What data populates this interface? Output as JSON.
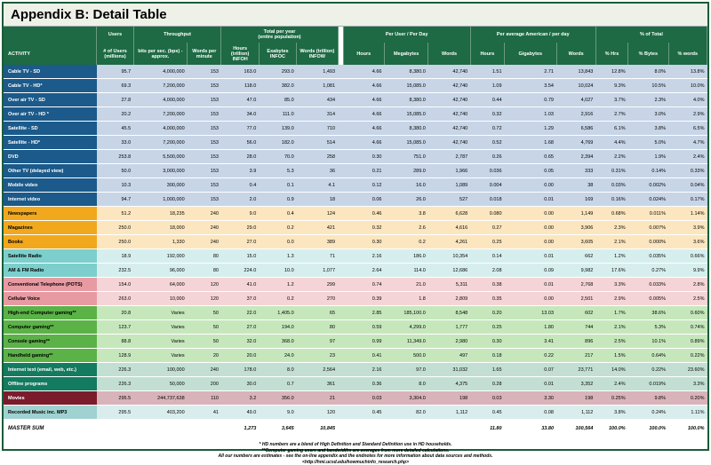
{
  "title": "Appendix B: Detail Table",
  "header_groups": {
    "users": "Users",
    "throughput": "Throughput",
    "total_per_year": "Total per year",
    "total_per_year_sub": "(entire population)",
    "per_user_day": "Per User / Per Day",
    "per_american_day": "Per average American / per day",
    "pct_total": "% of Total"
  },
  "columns": [
    "ACTIVITY",
    "# of Users (millions)",
    "bits per sec. (bps) - approx.",
    "Words per minute",
    "Hours (trillion) INFOH",
    "Exabytes INFOC",
    "Words (trillion) INFOW",
    "Hours",
    "Megabytes",
    "Words",
    "Hours",
    "Gigabytes",
    "Words",
    "% Hrs",
    "% Bytes",
    "% words"
  ],
  "colors": {
    "header_bg": "#1d6a44",
    "tv_label": "#1b5a8a",
    "tv_row": "#c7d5e7",
    "print_label": "#f2a81c",
    "print_row": "#fce6bf",
    "radio_label": "#7ccfcc",
    "radio_row": "#d6efee",
    "phone_label": "#e89aa2",
    "phone_row": "#f5d4d7",
    "game_label": "#5bb247",
    "game_row": "#c6e7bc",
    "net_label": "#137b5f",
    "net_row": "#c3dfd4",
    "movie_label": "#7b1c2c",
    "movie_row": "#d9b3ba",
    "mp3_label": "#9fd2d0",
    "mp3_row": "#d9eded"
  },
  "rows": [
    {
      "group": "tv",
      "cells": [
        "Cable TV - SD",
        "95.7",
        "4,000,000",
        "153",
        "163.0",
        "293.0",
        "1,493",
        "4.66",
        "8,380.0",
        "42,740",
        "1.51",
        "2.71",
        "13,843",
        "12.8%",
        "8.0%",
        "13.8%"
      ]
    },
    {
      "group": "tv",
      "cells": [
        "Cable TV - HD*",
        "69.3",
        "7,200,000",
        "153",
        "118.0",
        "382.0",
        "1,081",
        "4.66",
        "15,085.0",
        "42,740",
        "1.09",
        "3.54",
        "10,024",
        "9.3%",
        "10.5%",
        "10.0%"
      ]
    },
    {
      "group": "tv",
      "cells": [
        "Over air TV - SD",
        "27.8",
        "4,000,000",
        "153",
        "47.0",
        "85.0",
        "434",
        "4.66",
        "8,380.0",
        "42,740",
        "0.44",
        "0.79",
        "4,027",
        "3.7%",
        "2.3%",
        "4.0%"
      ]
    },
    {
      "group": "tv",
      "cells": [
        "Over air TV - HD *",
        "20.2",
        "7,200,000",
        "153",
        "34.0",
        "111.0",
        "314",
        "4.66",
        "15,085.0",
        "42,740",
        "0.32",
        "1.03",
        "2,916",
        "2.7%",
        "3.0%",
        "2.9%"
      ]
    },
    {
      "group": "tv",
      "cells": [
        "Satellite - SD",
        "45.5",
        "4,000,000",
        "153",
        "77.0",
        "139.0",
        "710",
        "4.66",
        "8,380.0",
        "42,740",
        "0.72",
        "1.29",
        "6,586",
        "6.1%",
        "3.8%",
        "6.5%"
      ]
    },
    {
      "group": "tv",
      "cells": [
        "Satellite - HD*",
        "33.0",
        "7,200,000",
        "153",
        "56.0",
        "182.0",
        "514",
        "4.66",
        "15,085.0",
        "42,740",
        "0.52",
        "1.68",
        "4,769",
        "4.4%",
        "5.0%",
        "4.7%"
      ]
    },
    {
      "group": "tv",
      "cells": [
        "DVD",
        "253.8",
        "5,500,000",
        "153",
        "28.0",
        "70.0",
        "258",
        "0.30",
        "751.0",
        "2,787",
        "0.26",
        "0.65",
        "2,394",
        "2.2%",
        "1.9%",
        "2.4%"
      ]
    },
    {
      "group": "tv",
      "cells": [
        "Other TV (delayed view)",
        "50.0",
        "3,000,000",
        "153",
        "3.9",
        "5.3",
        "36",
        "0.21",
        "289.0",
        "1,966",
        "0.036",
        "0.05",
        "333",
        "0.31%",
        "0.14%",
        "0.33%"
      ]
    },
    {
      "group": "tv",
      "cells": [
        "Mobile video",
        "10.3",
        "300,000",
        "153",
        "0.4",
        "0.1",
        "4.1",
        "0.12",
        "16.0",
        "1,089",
        "0.004",
        "0.00",
        "38",
        "0.03%",
        "0.002%",
        "0.04%"
      ]
    },
    {
      "group": "tv",
      "cells": [
        "Internet video",
        "94.7",
        "1,000,000",
        "153",
        "2.0",
        "0.9",
        "18",
        "0.06",
        "26.0",
        "527",
        "0.018",
        "0.01",
        "169",
        "0.16%",
        "0.024%",
        "0.17%"
      ]
    },
    {
      "group": "print",
      "cells": [
        "Newspapers",
        "51.2",
        "18,235",
        "240",
        "9.0",
        "0.4",
        "124",
        "0.46",
        "3.8",
        "6,628",
        "0.080",
        "0.00",
        "1,149",
        "0.68%",
        "0.011%",
        "1.14%"
      ]
    },
    {
      "group": "print",
      "cells": [
        "Magazines",
        "250.0",
        "18,000",
        "240",
        "29.0",
        "0.2",
        "421",
        "0.32",
        "2.6",
        "4,616",
        "0.27",
        "0.00",
        "3,906",
        "2.3%",
        "0.007%",
        "3.9%"
      ]
    },
    {
      "group": "print",
      "cells": [
        "Books",
        "250.0",
        "1,330",
        "240",
        "27.0",
        "0.0",
        "389",
        "0.30",
        "0.2",
        "4,261",
        "0.25",
        "0.00",
        "3,605",
        "2.1%",
        "0.000%",
        "3.6%"
      ]
    },
    {
      "group": "radio",
      "cells": [
        "Satellite Radio",
        "18.9",
        "192,000",
        "80",
        "15.0",
        "1.3",
        "71",
        "2.16",
        "186.0",
        "10,354",
        "0.14",
        "0.01",
        "662",
        "1.2%",
        "0.035%",
        "0.66%"
      ]
    },
    {
      "group": "radio",
      "cells": [
        "AM & FM Radio",
        "232.5",
        "96,000",
        "80",
        "224.0",
        "10.0",
        "1,077",
        "2.64",
        "114.0",
        "12,686",
        "2.08",
        "0.09",
        "9,982",
        "17.6%",
        "0.27%",
        "9.9%"
      ]
    },
    {
      "group": "phone",
      "cells": [
        "Conventional Telephone (POTS)",
        "154.0",
        "64,000",
        "120",
        "41.0",
        "1.2",
        "299",
        "0.74",
        "21.0",
        "5,311",
        "0.38",
        "0.01",
        "2,768",
        "3.3%",
        "0.033%",
        "2.8%"
      ]
    },
    {
      "group": "phone",
      "cells": [
        "Cellular Voice",
        "263.0",
        "10,000",
        "120",
        "37.0",
        "0.2",
        "270",
        "0.39",
        "1.8",
        "2,809",
        "0.35",
        "0.00",
        "2,501",
        "2.9%",
        "0.005%",
        "2.5%"
      ]
    },
    {
      "group": "game",
      "cells": [
        "High-end Computer gaming**",
        "20.8",
        "Varies",
        "50",
        "22.0",
        "1,405.0",
        "65",
        "2.85",
        "185,100.0",
        "8,548",
        "0.20",
        "13.03",
        "602",
        "1.7%",
        "38.6%",
        "0.60%"
      ]
    },
    {
      "group": "game",
      "cells": [
        "Computer gaming**",
        "123.7",
        "Varies",
        "50",
        "27.0",
        "194.0",
        "80",
        "0.59",
        "4,299.0",
        "1,777",
        "0.25",
        "1.80",
        "744",
        "2.1%",
        "5.3%",
        "0.74%"
      ]
    },
    {
      "group": "game",
      "cells": [
        "Console gaming**",
        "88.8",
        "Varies",
        "50",
        "32.0",
        "368.0",
        "97",
        "0.99",
        "11,349.0",
        "2,980",
        "0.30",
        "3.41",
        "896",
        "2.5%",
        "10.1%",
        "0.89%"
      ]
    },
    {
      "group": "game",
      "cells": [
        "Handheld gaming**",
        "128.9",
        "Varies",
        "20",
        "20.0",
        "24.0",
        "23",
        "0.41",
        "500.0",
        "497",
        "0.18",
        "0.22",
        "217",
        "1.5%",
        "0.64%",
        "0.22%"
      ]
    },
    {
      "group": "net",
      "cells": [
        "Internet text (email, web, etc.)",
        "226.3",
        "100,000",
        "240",
        "178.0",
        "8.0",
        "2,564",
        "2.16",
        "97.0",
        "31,032",
        "1.65",
        "0.07",
        "23,771",
        "14.0%",
        "0.22%",
        "23.60%"
      ]
    },
    {
      "group": "net",
      "cells": [
        "Offline programs",
        "226.3",
        "50,000",
        "200",
        "30.0",
        "0.7",
        "361",
        "0.36",
        "8.0",
        "4,375",
        "0.28",
        "0.01",
        "3,352",
        "2.4%",
        "0.019%",
        "3.3%"
      ]
    },
    {
      "group": "movie",
      "cells": [
        "Movies",
        "295.5",
        "244,737,638",
        "110",
        "3.2",
        "356.0",
        "21",
        "0.03",
        "3,304.0",
        "198",
        "0.03",
        "3.30",
        "198",
        "0.25%",
        "9.8%",
        "0.20%"
      ]
    },
    {
      "group": "mp3",
      "cells": [
        "Recorded Music inc. MP3",
        "295.5",
        "403,200",
        "41",
        "49.0",
        "9.0",
        "120",
        "0.45",
        "82.0",
        "1,112",
        "0.45",
        "0.08",
        "1,112",
        "3.8%",
        "0.24%",
        "1.11%"
      ]
    }
  ],
  "master_sum": {
    "label": "MASTER SUM",
    "hours_trillion": "1,273",
    "exabytes": "3,645",
    "words_trillion": "10,845",
    "hours": "11.80",
    "gigabytes": "33.80",
    "words": "100,564",
    "pct_hrs": "100.0%",
    "pct_bytes": "100.0%",
    "pct_words": "100.0%"
  },
  "notes": [
    "* HD numbers are a blend of High Definition and Standard Definition use in HD households.",
    "**Computer gaming users and bandwidths are averages from more detailed calculations.",
    "All our numbers are estimates - see the on-line appendix and the endnotes for more information about data sources and methods.",
    "<http://hmi.ucsd.edu/howmuchinfo_research.php>"
  ]
}
